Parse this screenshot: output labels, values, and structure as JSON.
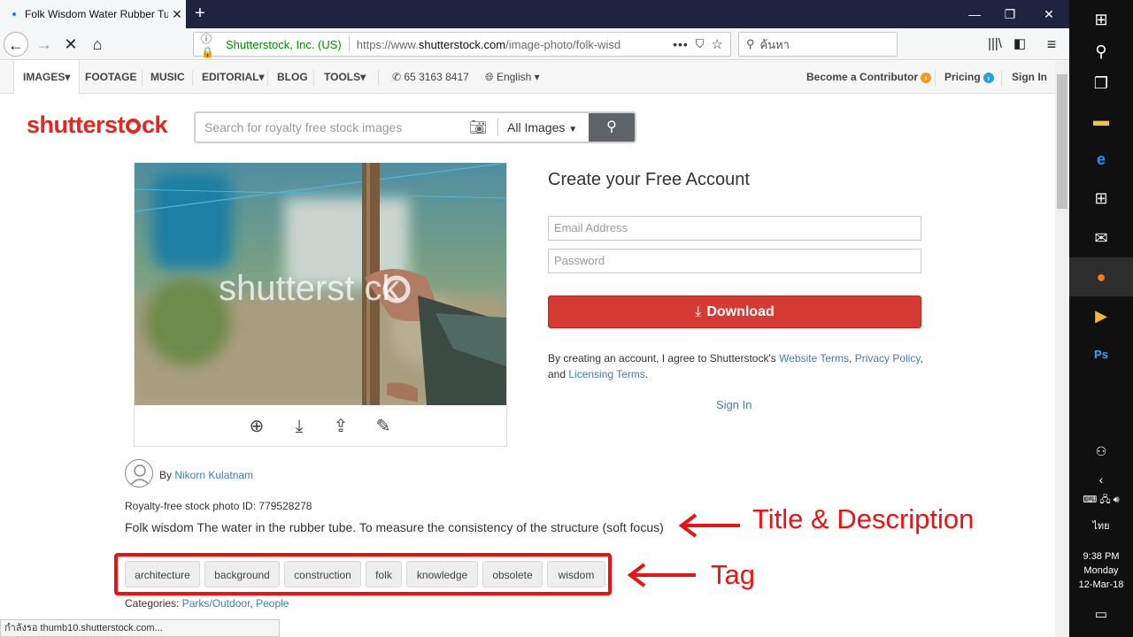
{
  "browser": {
    "tab_title": "Folk Wisdom Water Rubber Tu",
    "newtab": "+",
    "url_org": "Shutterstock, Inc. (US)",
    "url_prefix": "https://www.",
    "url_domain": "shutterstock.com",
    "url_path": "/image-photo/folk-wisd",
    "url_more": "•••",
    "search_placeholder": "ค้นหา"
  },
  "sitenav": {
    "items": [
      "IMAGES▾",
      "FOOTAGE",
      "MUSIC",
      "EDITORIAL▾",
      "BLOG",
      "TOOLS▾"
    ],
    "phone": "65 3163 8417",
    "language": "English ▾",
    "contributor": "Become a Contributor",
    "pricing": "Pricing",
    "signin": "Sign In"
  },
  "search": {
    "placeholder": "Search for royalty free stock images",
    "scope": "All Images"
  },
  "photo": {
    "watermark": "shutterst   ck"
  },
  "account": {
    "title": "Create your Free Account",
    "email_placeholder": "Email Address",
    "password_placeholder": "Password",
    "download": "Download",
    "terms_pre": "By creating an account, I agree to Shutterstock's ",
    "terms_link1": "Website Terms",
    "terms_comma": ", ",
    "terms_link2": "Privacy Policy",
    "terms_and": ", and ",
    "terms_link3": "Licensing Terms",
    "terms_end": ".",
    "signin": "Sign In"
  },
  "details": {
    "by": "By ",
    "author": "Nikorn Kulatnam",
    "photo_id": "Royalty-free stock photo ID: 779528278",
    "description": "Folk wisdom The water in the rubber tube. To measure the consistency of the structure (soft focus)",
    "tags": [
      "architecture",
      "background",
      "construction",
      "folk",
      "knowledge",
      "obsolete",
      "wisdom"
    ],
    "categories_label": "Categories: ",
    "cat1": "Parks/Outdoor",
    "cat_sep": ", ",
    "cat2": "People"
  },
  "annotations": {
    "title_desc": "Title & Description",
    "tag": "Tag"
  },
  "status": "กำลังรอ thumb10.shutterstock.com...",
  "taskbar": {
    "lang": "ไทย",
    "time": "9:38 PM",
    "day": "Monday",
    "date": "12-Mar-18"
  },
  "colors": {
    "brand_red": "#e0281f",
    "download_red": "#d53b33",
    "link_blue": "#3b7fb4",
    "annotation_red": "#ee1111"
  }
}
